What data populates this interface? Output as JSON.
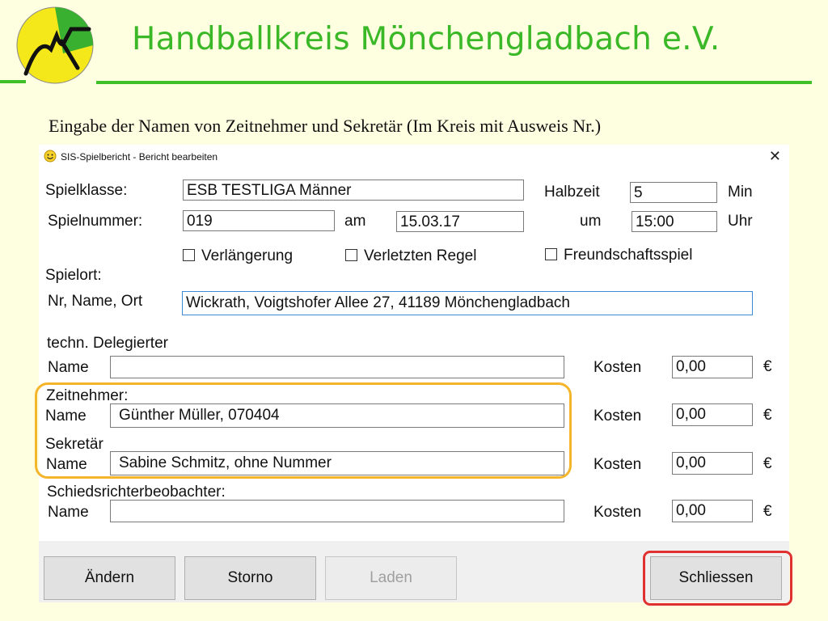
{
  "slide": {
    "title": "Handballkreis Mönchengladbach e.V.",
    "caption": "Eingabe der Namen von Zeitnehmer und Sekretär (Im Kreis mit Ausweis Nr.)"
  },
  "window": {
    "title": "SIS-Spielbericht - Bericht bearbeiten",
    "close": "✕"
  },
  "form": {
    "spielklasse_label": "Spielklasse:",
    "spielklasse_value": "ESB TESTLIGA Männer",
    "halbzeit_label": "Halbzeit",
    "halbzeit_value": "5",
    "min_label": "Min",
    "spielnummer_label": "Spielnummer:",
    "spielnummer_value": "019",
    "am_label": "am",
    "date_value": "15.03.17",
    "um_label": "um",
    "time_value": "15:00",
    "uhr_label": "Uhr",
    "checkboxes": [
      "Verlängerung",
      "Verletzten Regel",
      "Freundschaftsspiel"
    ],
    "spielort_label": "Spielort:",
    "nr_name_ort_label": "Nr, Name, Ort",
    "spielort_value": "Wickrath, Voigtshofer Allee 27, 41189 Mönchengladbach",
    "delegierter_label": "techn. Delegierter",
    "zeitnehmer_label": "Zeitnehmer:",
    "sekretaer_label": "Sekretär",
    "beobachter_label": "Schiedsrichterbeobachter:",
    "name_label": "Name",
    "kosten_label": "Kosten",
    "euro": "€",
    "rows": [
      {
        "name": "",
        "kosten": "0,00"
      },
      {
        "name": "Günther Müller, 070404",
        "kosten": "0,00"
      },
      {
        "name": "Sabine Schmitz, ohne Nummer",
        "kosten": "0,00"
      },
      {
        "name": "",
        "kosten": "0,00"
      }
    ]
  },
  "buttons": {
    "aendern": "Ändern",
    "storno": "Storno",
    "laden": "Laden",
    "schliessen": "Schliessen"
  },
  "colors": {
    "accent_green": "#3bb827",
    "highlight_orange": "#f5b52a",
    "highlight_red": "#e03030"
  }
}
